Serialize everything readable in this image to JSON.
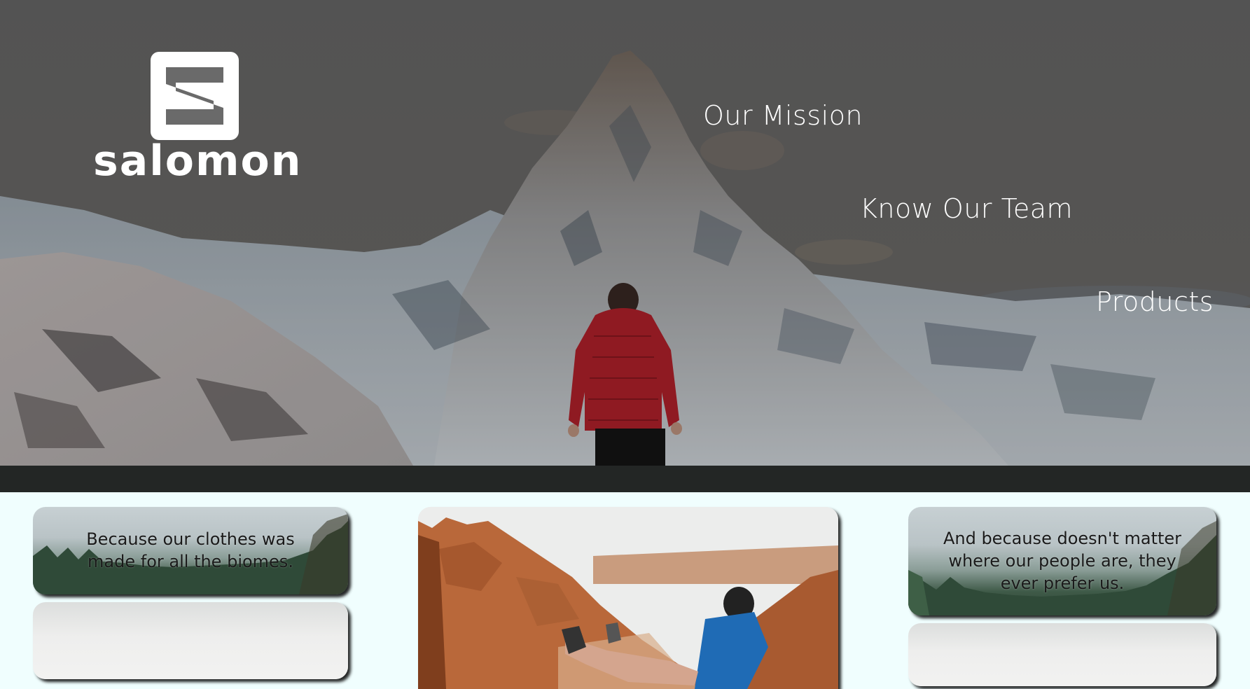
{
  "brand": {
    "name": "salomon",
    "logo_icon": "salomon-s-logo"
  },
  "nav": {
    "items": [
      {
        "label": "Our Mission"
      },
      {
        "label": "Know Our Team"
      },
      {
        "label": "Products"
      }
    ]
  },
  "cards": {
    "left_top_text": "Because our clothes was made for all the biomes.",
    "right_top_text": "And because doesn't matter where our people are, they ever prefer us."
  },
  "colors": {
    "page_background": "#f0fefe",
    "band": "#232625",
    "nav_text": "#ffffff",
    "jacket_red": "#b8222c"
  }
}
